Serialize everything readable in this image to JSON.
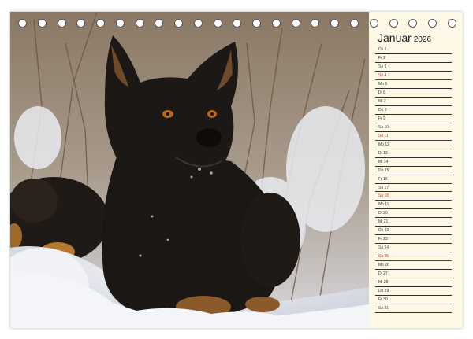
{
  "calendar": {
    "month": "Januar",
    "year": "2026",
    "days": [
      {
        "label": "Do 1",
        "weekday": "Do"
      },
      {
        "label": "Fr 2",
        "weekday": "Fr"
      },
      {
        "label": "Sa 3",
        "weekday": "Sa"
      },
      {
        "label": "So 4",
        "weekday": "So"
      },
      {
        "label": "Mo 5",
        "weekday": "Mo"
      },
      {
        "label": "Di 6",
        "weekday": "Di"
      },
      {
        "label": "Mi 7",
        "weekday": "Mi"
      },
      {
        "label": "Do 8",
        "weekday": "Do"
      },
      {
        "label": "Fr 9",
        "weekday": "Fr"
      },
      {
        "label": "Sa 10",
        "weekday": "Sa"
      },
      {
        "label": "So 11",
        "weekday": "So"
      },
      {
        "label": "Mo 12",
        "weekday": "Mo"
      },
      {
        "label": "Di 13",
        "weekday": "Di"
      },
      {
        "label": "Mi 14",
        "weekday": "Mi"
      },
      {
        "label": "Do 15",
        "weekday": "Do"
      },
      {
        "label": "Fr 16",
        "weekday": "Fr"
      },
      {
        "label": "Sa 17",
        "weekday": "Sa"
      },
      {
        "label": "So 18",
        "weekday": "So"
      },
      {
        "label": "Mo 19",
        "weekday": "Mo"
      },
      {
        "label": "Di 20",
        "weekday": "Di"
      },
      {
        "label": "Mi 21",
        "weekday": "Mi"
      },
      {
        "label": "Do 22",
        "weekday": "Do"
      },
      {
        "label": "Fr 23",
        "weekday": "Fr"
      },
      {
        "label": "Sa 24",
        "weekday": "Sa"
      },
      {
        "label": "So 25",
        "weekday": "So"
      },
      {
        "label": "Mo 26",
        "weekday": "Mo"
      },
      {
        "label": "Di 27",
        "weekday": "Di"
      },
      {
        "label": "Mi 28",
        "weekday": "Mi"
      },
      {
        "label": "Do 29",
        "weekday": "Do"
      },
      {
        "label": "Fr 30",
        "weekday": "Fr"
      },
      {
        "label": "Sa 31",
        "weekday": "Sa"
      }
    ]
  },
  "colors": {
    "page_bg": "#fdf8e6",
    "sunday_text": "#c0392b",
    "line": "#2d2d2d"
  },
  "binding_rings": 23
}
